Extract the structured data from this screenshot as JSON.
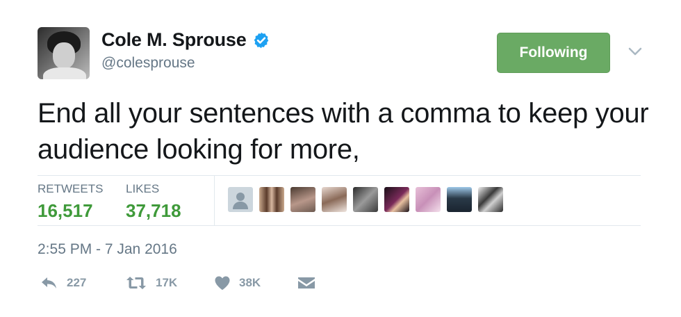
{
  "user": {
    "display_name": "Cole M. Sprouse",
    "handle": "@colesprouse",
    "verified": true
  },
  "follow_button": {
    "label": "Following"
  },
  "tweet": {
    "text": "End all your sentences with a comma to keep your audience looking for more,"
  },
  "stats": {
    "retweets_label": "RETWEETS",
    "retweets_value": "16,517",
    "likes_label": "LIKES",
    "likes_value": "37,718"
  },
  "timestamp": "2:55 PM - 7 Jan 2016",
  "actions": {
    "reply_count": "227",
    "retweet_count": "17K",
    "like_count": "38K"
  },
  "colors": {
    "following_green": "#6aaa64",
    "stat_green": "#3f9a3a",
    "verified_blue": "#1da1f2",
    "muted_gray": "#657786"
  },
  "icons": {
    "reply": "reply-icon",
    "retweet": "retweet-icon",
    "like": "heart-icon",
    "dm": "envelope-icon",
    "more": "chevron-down-icon",
    "verified": "verified-badge-icon"
  }
}
